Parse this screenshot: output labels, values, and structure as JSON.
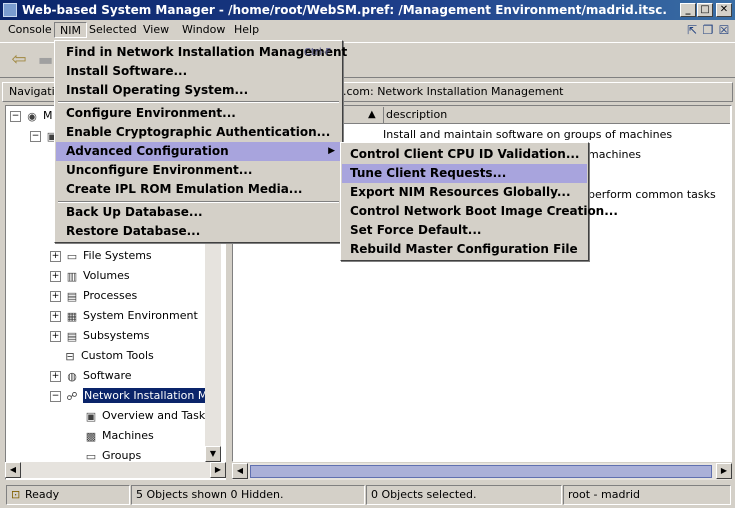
{
  "window": {
    "title": "Web-based System Manager - /home/root/WebSM.pref: /Management Environment/madrid.itsc.austin.ibm.com/...",
    "minimize": "_",
    "maximize": "□",
    "close": "✕"
  },
  "menubar": {
    "items": [
      "Console",
      "NIM",
      "Selected",
      "View",
      "Window",
      "Help"
    ]
  },
  "nav": {
    "header": "Navigation Area",
    "content_header": ".com: Network Installation Management"
  },
  "tree": {
    "root_label": "M",
    "items": [
      {
        "label": "File Systems"
      },
      {
        "label": "Volumes"
      },
      {
        "label": "Processes"
      },
      {
        "label": "System Environment"
      },
      {
        "label": "Subsystems"
      },
      {
        "label": "Custom Tools"
      },
      {
        "label": "Software"
      },
      {
        "label": "Network Installation Management"
      },
      {
        "label": "Overview and Tasks"
      },
      {
        "label": "Machines"
      },
      {
        "label": "Groups"
      }
    ]
  },
  "content": {
    "column_header": "description",
    "rows": [
      "Install and maintain software on groups of machines",
      "machines",
      "perform common tasks"
    ]
  },
  "nim_menu": {
    "items": [
      {
        "label": "Find in Network Installation Management",
        "shortcut": "Ctrl-F"
      },
      {
        "label": "Install Software..."
      },
      {
        "label": "Install Operating System..."
      },
      {
        "label": "Configure Environment..."
      },
      {
        "label": "Enable Cryptographic Authentication..."
      },
      {
        "label": "Advanced Configuration"
      },
      {
        "label": "Unconfigure Environment..."
      },
      {
        "label": "Create IPL ROM Emulation Media..."
      },
      {
        "label": "Back Up Database..."
      },
      {
        "label": "Restore Database..."
      }
    ]
  },
  "submenu": {
    "items": [
      {
        "label": "Control Client CPU ID Validation..."
      },
      {
        "label": "Tune Client Requests..."
      },
      {
        "label": "Export NIM Resources Globally..."
      },
      {
        "label": "Control Network Boot Image Creation..."
      },
      {
        "label": "Set Force Default..."
      },
      {
        "label": "Rebuild Master Configuration File"
      }
    ]
  },
  "status": {
    "ready": "Ready",
    "objects_shown": "5 Objects shown 0 Hidden.",
    "objects_selected": "0 Objects selected.",
    "user_host": "root - madrid"
  },
  "colors": {
    "titlebar": "#0a246a",
    "highlight": "#a8a4dd",
    "selection": "#0a246a"
  }
}
